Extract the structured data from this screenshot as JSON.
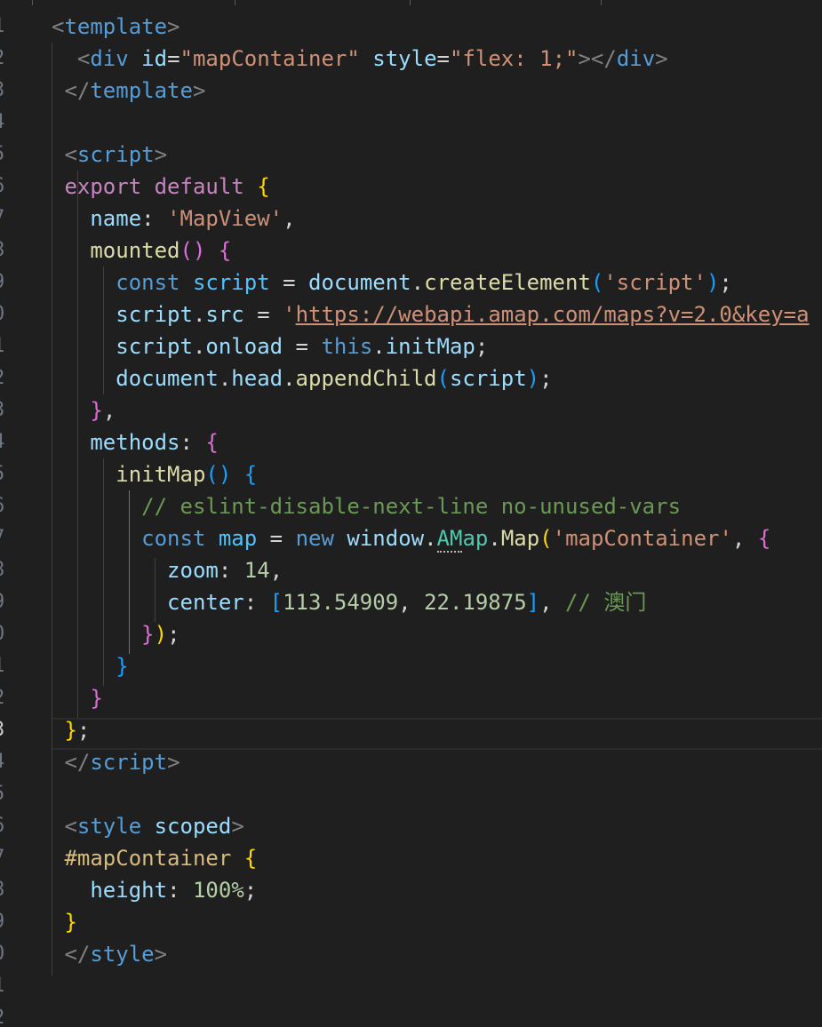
{
  "editor": {
    "language": "vue",
    "theme": {
      "background": "#1f1f1f",
      "guide_color": "#404040"
    },
    "line_numbers": [
      "1",
      "2",
      "3",
      "4",
      "5",
      "6",
      "7",
      "8",
      "9",
      "0",
      "1",
      "2",
      "3",
      "4",
      "5",
      "6",
      "7",
      "8",
      "9",
      "0",
      "1",
      "2",
      "3",
      "4",
      "5",
      "6",
      "7",
      "8",
      "9",
      "0",
      "1",
      "2"
    ],
    "current_line_index": 22,
    "lines": [
      [
        [
          "t-punct",
          "<"
        ],
        [
          "t-tag",
          "template"
        ],
        [
          "t-punct",
          ">"
        ]
      ],
      [
        [
          "t-plain",
          "  "
        ],
        [
          "t-punct",
          "<"
        ],
        [
          "t-tag",
          "div"
        ],
        [
          "t-plain",
          " "
        ],
        [
          "t-attr",
          "id"
        ],
        [
          "t-plain",
          "="
        ],
        [
          "t-str",
          "\"mapContainer\""
        ],
        [
          "t-plain",
          " "
        ],
        [
          "t-attr",
          "style"
        ],
        [
          "t-plain",
          "="
        ],
        [
          "t-str",
          "\"flex: 1;\""
        ],
        [
          "t-punct",
          "></"
        ],
        [
          "t-tag",
          "div"
        ],
        [
          "t-punct",
          ">"
        ]
      ],
      [
        [
          "t-plain",
          " "
        ],
        [
          "t-punct",
          "</"
        ],
        [
          "t-tag",
          "template"
        ],
        [
          "t-punct",
          ">"
        ]
      ],
      [],
      [
        [
          "t-plain",
          " "
        ],
        [
          "t-punct",
          "<"
        ],
        [
          "t-tag",
          "script"
        ],
        [
          "t-punct",
          ">"
        ]
      ],
      [
        [
          "t-plain",
          " "
        ],
        [
          "t-kw-pink",
          "export default"
        ],
        [
          "t-plain",
          " "
        ],
        [
          "b1",
          "{"
        ]
      ],
      [
        [
          "t-plain",
          "   "
        ],
        [
          "t-var",
          "name"
        ],
        [
          "t-plain",
          ": "
        ],
        [
          "t-str",
          "'MapView'"
        ],
        [
          "t-plain",
          ","
        ]
      ],
      [
        [
          "t-plain",
          "   "
        ],
        [
          "t-fn",
          "mounted"
        ],
        [
          "b2",
          "()"
        ],
        [
          "t-plain",
          " "
        ],
        [
          "b2",
          "{"
        ]
      ],
      [
        [
          "t-plain",
          "     "
        ],
        [
          "t-kw-blue",
          "const"
        ],
        [
          "t-plain",
          " "
        ],
        [
          "t-var2",
          "script"
        ],
        [
          "t-plain",
          " = "
        ],
        [
          "t-var",
          "document"
        ],
        [
          "t-plain",
          "."
        ],
        [
          "t-fn",
          "createElement"
        ],
        [
          "b3",
          "("
        ],
        [
          "t-str",
          "'script'"
        ],
        [
          "b3",
          ")"
        ],
        [
          "t-plain",
          ";"
        ]
      ],
      [
        [
          "t-plain",
          "     "
        ],
        [
          "t-var",
          "script"
        ],
        [
          "t-plain",
          "."
        ],
        [
          "t-var",
          "src"
        ],
        [
          "t-plain",
          " = "
        ],
        [
          "t-str",
          "'"
        ],
        [
          "t-str url",
          "https://webapi.amap.com/maps?v=2.0&key=a"
        ]
      ],
      [
        [
          "t-plain",
          "     "
        ],
        [
          "t-var",
          "script"
        ],
        [
          "t-plain",
          "."
        ],
        [
          "t-var",
          "onload"
        ],
        [
          "t-plain",
          " = "
        ],
        [
          "t-kw-blue",
          "this"
        ],
        [
          "t-plain",
          "."
        ],
        [
          "t-var",
          "initMap"
        ],
        [
          "t-plain",
          ";"
        ]
      ],
      [
        [
          "t-plain",
          "     "
        ],
        [
          "t-var",
          "document"
        ],
        [
          "t-plain",
          "."
        ],
        [
          "t-var",
          "head"
        ],
        [
          "t-plain",
          "."
        ],
        [
          "t-fn",
          "appendChild"
        ],
        [
          "b3",
          "("
        ],
        [
          "t-var",
          "script"
        ],
        [
          "b3",
          ")"
        ],
        [
          "t-plain",
          ";"
        ]
      ],
      [
        [
          "t-plain",
          "   "
        ],
        [
          "b2",
          "}"
        ],
        [
          "t-plain",
          ","
        ]
      ],
      [
        [
          "t-plain",
          "   "
        ],
        [
          "t-var",
          "methods"
        ],
        [
          "t-plain",
          ": "
        ],
        [
          "b2",
          "{"
        ]
      ],
      [
        [
          "t-plain",
          "     "
        ],
        [
          "t-fn",
          "initMap"
        ],
        [
          "b3",
          "()"
        ],
        [
          "t-plain",
          " "
        ],
        [
          "b3",
          "{"
        ]
      ],
      [
        [
          "t-plain",
          "       "
        ],
        [
          "t-cmt",
          "// eslint-disable-next-line no-unused-vars"
        ]
      ],
      [
        [
          "t-plain",
          "       "
        ],
        [
          "t-kw-blue",
          "const"
        ],
        [
          "t-plain",
          " "
        ],
        [
          "t-var2",
          "map"
        ],
        [
          "t-plain",
          " = "
        ],
        [
          "t-kw-blue",
          "new"
        ],
        [
          "t-plain",
          " "
        ],
        [
          "t-var",
          "window"
        ],
        [
          "t-plain",
          "."
        ],
        [
          "t-cls dotted",
          "AM"
        ],
        [
          "t-cls",
          "ap"
        ],
        [
          "t-plain",
          "."
        ],
        [
          "t-fn",
          "Map"
        ],
        [
          "b1",
          "("
        ],
        [
          "t-str",
          "'mapContainer'"
        ],
        [
          "t-plain",
          ", "
        ],
        [
          "b2",
          "{"
        ]
      ],
      [
        [
          "t-plain",
          "         "
        ],
        [
          "t-var",
          "zoom"
        ],
        [
          "t-plain",
          ": "
        ],
        [
          "t-num",
          "14"
        ],
        [
          "t-plain",
          ","
        ]
      ],
      [
        [
          "t-plain",
          "         "
        ],
        [
          "t-var",
          "center"
        ],
        [
          "t-plain",
          ": "
        ],
        [
          "b3",
          "["
        ],
        [
          "t-num",
          "113.54909"
        ],
        [
          "t-plain",
          ", "
        ],
        [
          "t-num",
          "22.19875"
        ],
        [
          "b3",
          "]"
        ],
        [
          "t-plain",
          ", "
        ],
        [
          "t-cmt",
          "// 澳门"
        ]
      ],
      [
        [
          "t-plain",
          "       "
        ],
        [
          "b2",
          "}"
        ],
        [
          "b1",
          ")"
        ],
        [
          "t-plain",
          ";"
        ]
      ],
      [
        [
          "t-plain",
          "     "
        ],
        [
          "b3",
          "}"
        ]
      ],
      [
        [
          "t-plain",
          "   "
        ],
        [
          "b2",
          "}"
        ]
      ],
      [
        [
          "t-plain",
          " "
        ],
        [
          "b1",
          "}"
        ],
        [
          "t-plain",
          ";"
        ]
      ],
      [
        [
          "t-plain",
          " "
        ],
        [
          "t-punct",
          "</"
        ],
        [
          "t-tag",
          "script"
        ],
        [
          "t-punct",
          ">"
        ]
      ],
      [],
      [
        [
          "t-plain",
          " "
        ],
        [
          "t-punct",
          "<"
        ],
        [
          "t-tag",
          "style"
        ],
        [
          "t-plain",
          " "
        ],
        [
          "t-attr",
          "scoped"
        ],
        [
          "t-punct",
          ">"
        ]
      ],
      [
        [
          "t-plain",
          " "
        ],
        [
          "t-css-sel",
          "#mapContainer"
        ],
        [
          "t-plain",
          " "
        ],
        [
          "b1",
          "{"
        ]
      ],
      [
        [
          "t-plain",
          "   "
        ],
        [
          "t-attr",
          "height"
        ],
        [
          "t-plain",
          ": "
        ],
        [
          "t-num",
          "100%"
        ],
        [
          "t-plain",
          ";"
        ]
      ],
      [
        [
          "t-plain",
          " "
        ],
        [
          "b1",
          "}"
        ]
      ],
      [
        [
          "t-plain",
          " "
        ],
        [
          "t-punct",
          "</"
        ],
        [
          "t-tag",
          "style"
        ],
        [
          "t-punct",
          ">"
        ]
      ],
      [],
      []
    ]
  }
}
